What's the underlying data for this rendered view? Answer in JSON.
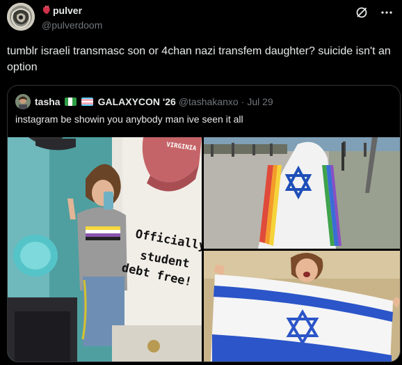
{
  "author": {
    "display_name": "pulver",
    "handle": "@pulverdoom"
  },
  "tweet": {
    "text": "tumblr israeli transmasc son or 4chan nazi transfem daughter? suicide isn't an option"
  },
  "quoted_tweet": {
    "display_name": "tasha",
    "event_name": "GALAXYCON '26",
    "handle": "@tashakanxo",
    "separator": "·",
    "date": "Jul 29",
    "text": "instagram be showin you anybody man ive seen it all"
  },
  "photos": {
    "first": {
      "handwritten_note": [
        "Officially",
        "student",
        "debt free!"
      ],
      "cap_text": "VIRGINIA"
    }
  },
  "icons": {
    "grok": "no-entry-slash-icon",
    "more": "ellipsis-icon",
    "heart": "anatomical-heart-icon"
  },
  "colors": {
    "text": "#e7e9ea",
    "muted": "#71767b",
    "border": "#2f3336",
    "background": "#000000"
  }
}
